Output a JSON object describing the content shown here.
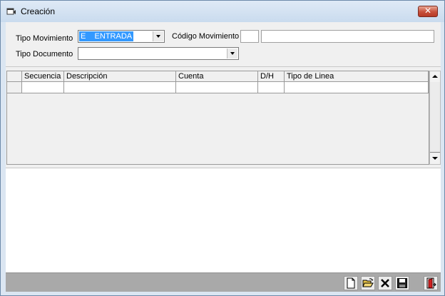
{
  "window": {
    "title": "Creación",
    "icons": {
      "app": "window-app-icon",
      "close": "close-icon"
    }
  },
  "form": {
    "tipo_movimiento": {
      "label": "Tipo Movimiento",
      "value": "E    ENTRADA"
    },
    "codigo_movimiento": {
      "label": "Código Movimiento",
      "code": "",
      "description": ""
    },
    "tipo_documento": {
      "label": "Tipo Documento",
      "value": ""
    }
  },
  "grid": {
    "columns": [
      "Secuencia",
      "Descripción",
      "Cuenta",
      "D/H",
      "Tipo de Linea"
    ],
    "rows": [
      [
        "",
        "",
        "",
        "",
        ""
      ]
    ]
  },
  "toolbar": {
    "buttons": [
      "new-document-icon",
      "open-folder-icon",
      "delete-x-icon",
      "save-disk-icon",
      "exit-door-icon"
    ]
  },
  "colors": {
    "titlebar": "#dbe6f2",
    "selection": "#3399ff",
    "panel": "#f0f0f0",
    "toolbar": "#a9a9a9",
    "close": "#c7503a"
  }
}
